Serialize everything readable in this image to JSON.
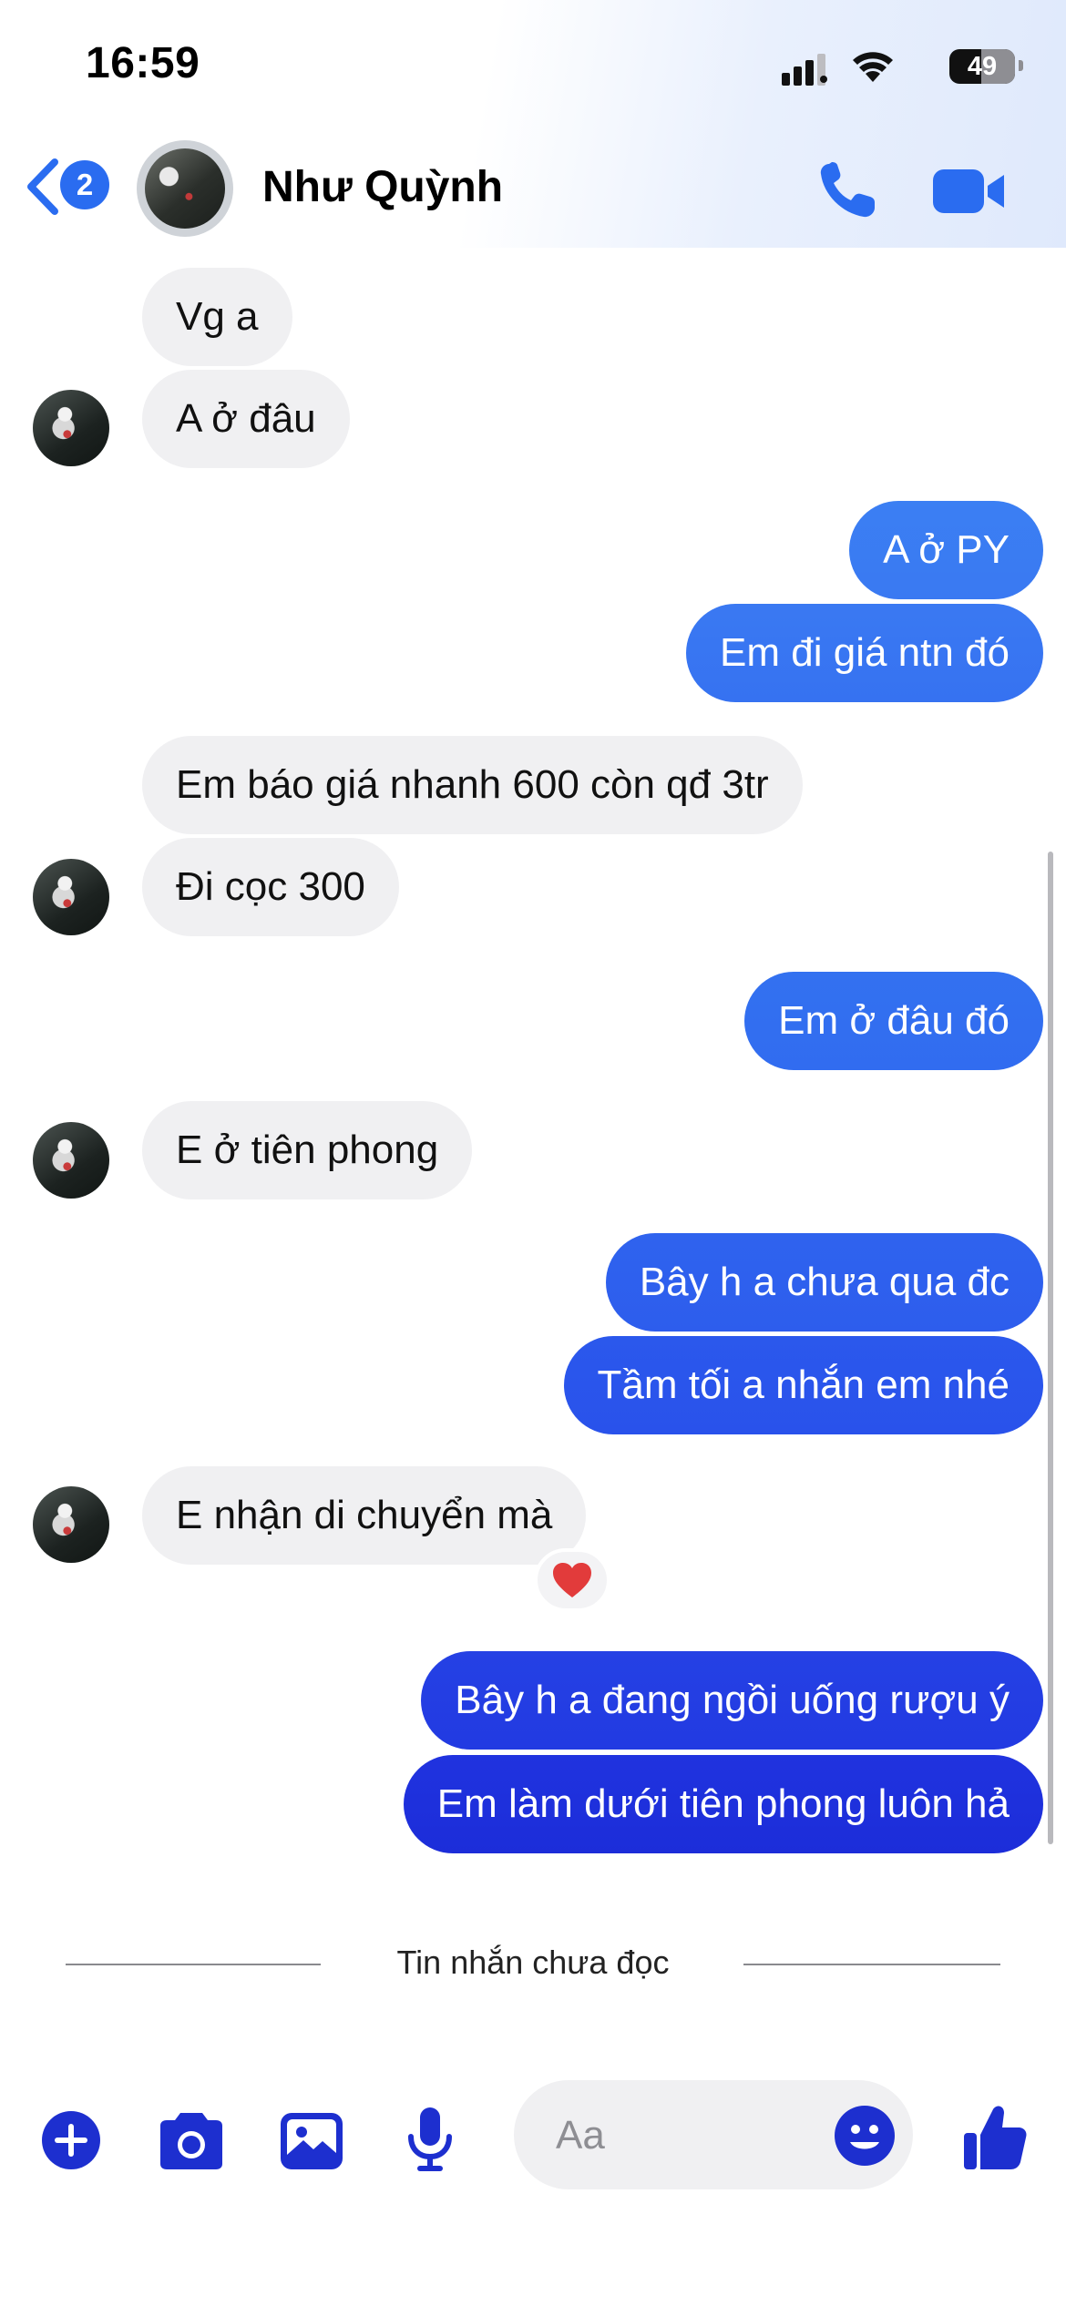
{
  "status_bar": {
    "time": "16:59",
    "battery": "49",
    "battery_level": 0.49
  },
  "header": {
    "back_badge": "2",
    "contact_name": "Như Quỳnh",
    "call_icon": "phone-icon",
    "video_icon": "video-camera-icon"
  },
  "messages": [
    {
      "from": "contact",
      "text": "Vg a"
    },
    {
      "from": "contact",
      "text": "A ở đâu"
    },
    {
      "from": "me",
      "text": "A ở PY"
    },
    {
      "from": "me",
      "text": "Em đi giá ntn đó"
    },
    {
      "from": "contact",
      "text": "Em báo giá nhanh 600 còn qđ 3tr"
    },
    {
      "from": "contact",
      "text": "Đi cọc 300"
    },
    {
      "from": "me",
      "text": "Em ở đâu đó"
    },
    {
      "from": "contact",
      "text": "E ở tiên phong"
    },
    {
      "from": "me",
      "text": "Bây h a chưa qua đc"
    },
    {
      "from": "me",
      "text": "Tầm tối a nhắn em nhé"
    },
    {
      "from": "contact",
      "text": "E nhận di chuyển mà",
      "reaction": "heart"
    },
    {
      "from": "me",
      "text": "Bây h a đang ngồi uống rượu ý"
    },
    {
      "from": "me",
      "text": "Em làm dưới tiên phong luôn hả"
    }
  ],
  "divider": {
    "label": "Tin nhắn chưa đọc"
  },
  "composer": {
    "placeholder": "Aa",
    "icons": [
      "plus-icon",
      "camera-icon",
      "image-icon",
      "microphone-icon",
      "emoji-icon",
      "thumbs-up-icon"
    ]
  },
  "colors": {
    "accent": "#2a6cf0",
    "bubble_out_top": "#3a7af2",
    "bubble_out_bottom": "#1a2fd6",
    "bubble_in": "#f0f0f2",
    "composer_icons": "#1d2fcf"
  }
}
